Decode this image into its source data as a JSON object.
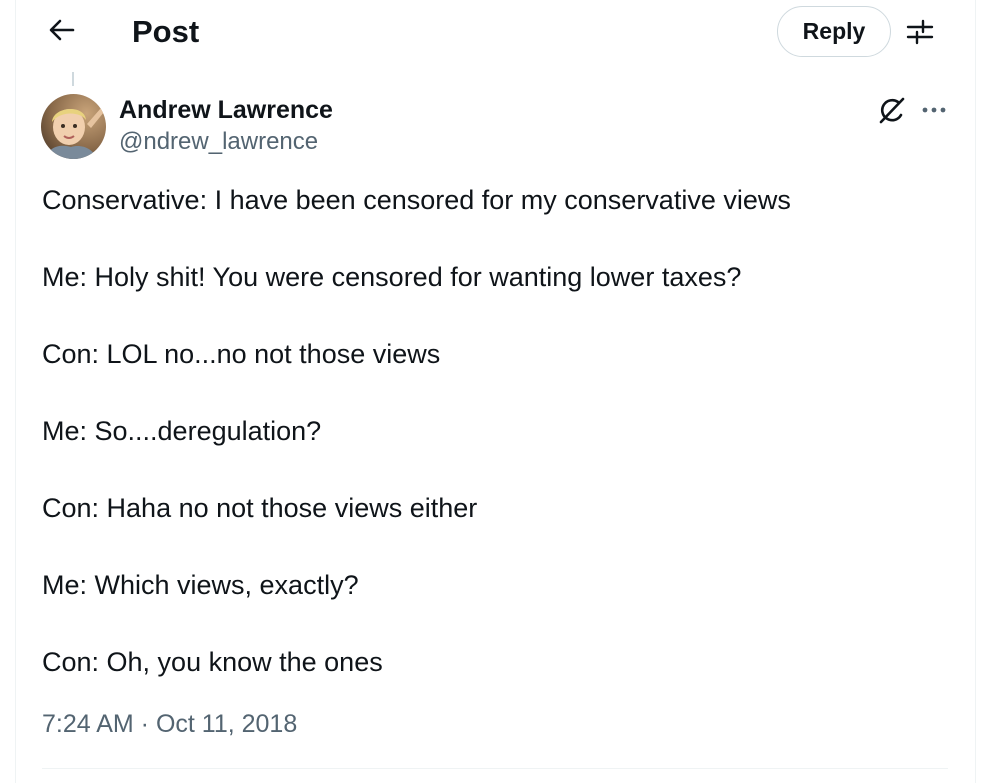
{
  "header": {
    "back_icon": "arrow-left-icon",
    "title": "Post",
    "reply_label": "Reply",
    "filter_icon": "sliders-icon"
  },
  "author": {
    "name": "Andrew Lawrence",
    "handle": "@ndrew_lawrence",
    "avatar_icon": "avatar-photo"
  },
  "actions": {
    "grok_icon": "grok-icon",
    "more_icon": "more-horizontal-icon"
  },
  "post": {
    "lines": [
      "Conservative: I have been censored for my conservative views",
      "Me: Holy shit! You were censored for wanting lower taxes?",
      "Con: LOL no...no not those views",
      "Me: So....deregulation?",
      "Con: Haha no not those views either",
      "Me: Which views, exactly?",
      "Con: Oh, you know the ones"
    ],
    "timestamp": "7:24 AM · Oct 11, 2018"
  },
  "colors": {
    "text": "#0f1419",
    "secondary": "#536471",
    "border": "#cfd9de",
    "divider": "#eff3f4"
  }
}
